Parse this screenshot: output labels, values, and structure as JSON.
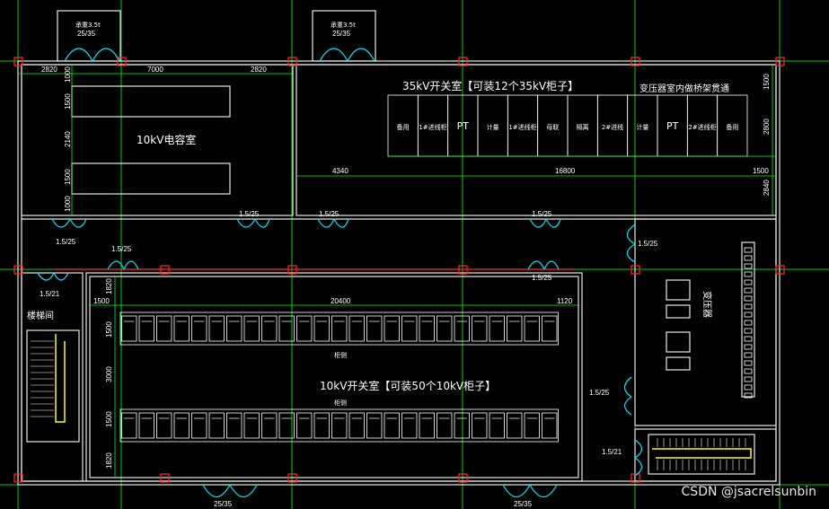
{
  "labels": {
    "room_10kv_capacitor": "10kV电容室",
    "room_35kv_switch": "35kV开关室【可装12个35kV柜子】",
    "room_10kv_switch": "10kV开关室【可装50个10kV柜子】",
    "tray_note": "变压器室内做桥架贯通",
    "stairwell": "楼梯间",
    "transformer": "变压器",
    "top_door_left_note": "承重3.5t",
    "top_door_right_note": "承重3.5t",
    "row_label_upper": "柜侧",
    "row_label_lower": "柜侧",
    "watermark": "CSDN @jsacrelsunbin"
  },
  "dimensions": {
    "d2820_left": "2820",
    "d7000": "7000",
    "d2820_right": "2820",
    "d1000_top": "1000",
    "d1500_a": "1500",
    "d2140": "2140",
    "d1500_b": "1500",
    "d1000_bottom": "1000",
    "d4340": "4340",
    "d16800": "16800",
    "d1500_r1": "1500",
    "d2800": "2800",
    "d1500_r2": "1500",
    "d2840": "2840",
    "d1500_left": "1500",
    "d1820_top": "1820",
    "d20400": "20400",
    "d1120": "1120",
    "d1500_row1": "1500",
    "d3000": "3000",
    "d1500_row2": "1500",
    "d1820_bottom": "1820"
  },
  "door_tags": {
    "top_left": "25/35",
    "top_right": "25/35",
    "mid_1": "1.5/25",
    "mid_2": "1.5/25",
    "mid_3": "1.5/25",
    "left_corridor": "1.5/25",
    "corridor_2": "1.5/25",
    "right_upper": "1.5/25",
    "stair": "1.5/21",
    "switch_right": "1.5/25",
    "switch_lower_right": "1.5/25",
    "bottom_stair": "1.5/21",
    "bottom_left": "25/35",
    "bottom_right": "25/35"
  },
  "cabinets_35kv": [
    "备用",
    "1#进线柜",
    "PT",
    "计量",
    "1#进线柜",
    "母联",
    "隔离",
    "2#进线",
    "计量",
    "PT",
    "2#进线柜",
    "备用"
  ],
  "transformer_units": [
    "变压器",
    "变压器"
  ],
  "colors": {
    "background": "#000000",
    "grid": "#00d000",
    "wall": "#e8e8e8",
    "door": "#00e5ff",
    "column": "#ff2020",
    "text": "#ffffff"
  }
}
